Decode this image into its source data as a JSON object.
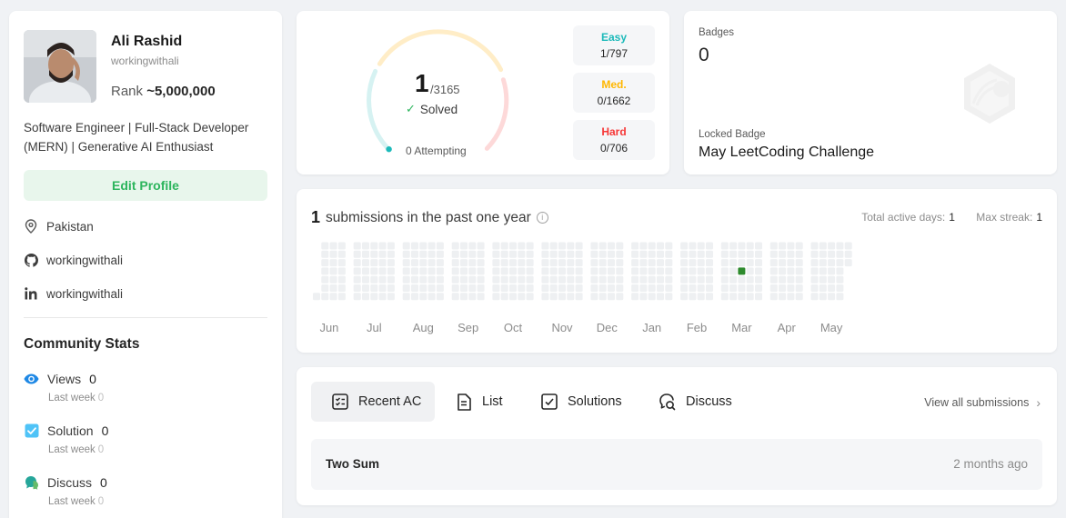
{
  "profile": {
    "name": "Ali Rashid",
    "username": "workingwithali",
    "rank_label": "Rank",
    "rank_value": "~5,000,000",
    "bio": "Software Engineer | Full-Stack Developer (MERN) | Generative AI Enthusiast",
    "edit_button": "Edit Profile",
    "location": "Pakistan",
    "github": "workingwithali",
    "linkedin": "workingwithali"
  },
  "community_stats": {
    "title": "Community Stats",
    "items": [
      {
        "label": "Views",
        "value": "0",
        "sub_label": "Last week",
        "sub_value": "0",
        "icon": "eye-icon",
        "color": "#1e88e5"
      },
      {
        "label": "Solution",
        "value": "0",
        "sub_label": "Last week",
        "sub_value": "0",
        "icon": "check-square-icon",
        "color": "#4fc3f7"
      },
      {
        "label": "Discuss",
        "value": "0",
        "sub_label": "Last week",
        "sub_value": "0",
        "icon": "chat-bubble-icon",
        "color": "#26a69a"
      }
    ]
  },
  "solved": {
    "count": "1",
    "total": "/3165",
    "label": "Solved",
    "attempting": "0 Attempting",
    "difficulties": [
      {
        "label": "Easy",
        "value": "1/797",
        "color": "#1cbaba"
      },
      {
        "label": "Med.",
        "value": "0/1662",
        "color": "#ffb700"
      },
      {
        "label": "Hard",
        "value": "0/706",
        "color": "#f63737"
      }
    ]
  },
  "badges": {
    "label": "Badges",
    "count": "0",
    "locked_label": "Locked Badge",
    "locked_name": "May LeetCoding Challenge"
  },
  "submissions": {
    "count": "1",
    "text": "submissions in the past one year",
    "active_days_label": "Total active days:",
    "active_days": "1",
    "max_streak_label": "Max streak:",
    "max_streak": "1",
    "months": [
      "Jun",
      "Jul",
      "Aug",
      "Sep",
      "Oct",
      "Nov",
      "Dec",
      "Jan",
      "Feb",
      "Mar",
      "Apr",
      "May"
    ],
    "active_cell": {
      "month": "Mar",
      "week": 2,
      "day": 3
    },
    "colors": {
      "empty": "#eef0f2",
      "active": "#2d8a2d"
    }
  },
  "recent": {
    "tabs": [
      {
        "label": "Recent AC",
        "icon": "recent-ac-icon"
      },
      {
        "label": "List",
        "icon": "list-icon"
      },
      {
        "label": "Solutions",
        "icon": "solutions-icon"
      },
      {
        "label": "Discuss",
        "icon": "discuss-icon"
      }
    ],
    "view_all": "View all submissions",
    "items": [
      {
        "title": "Two Sum",
        "time": "2 months ago"
      }
    ]
  }
}
